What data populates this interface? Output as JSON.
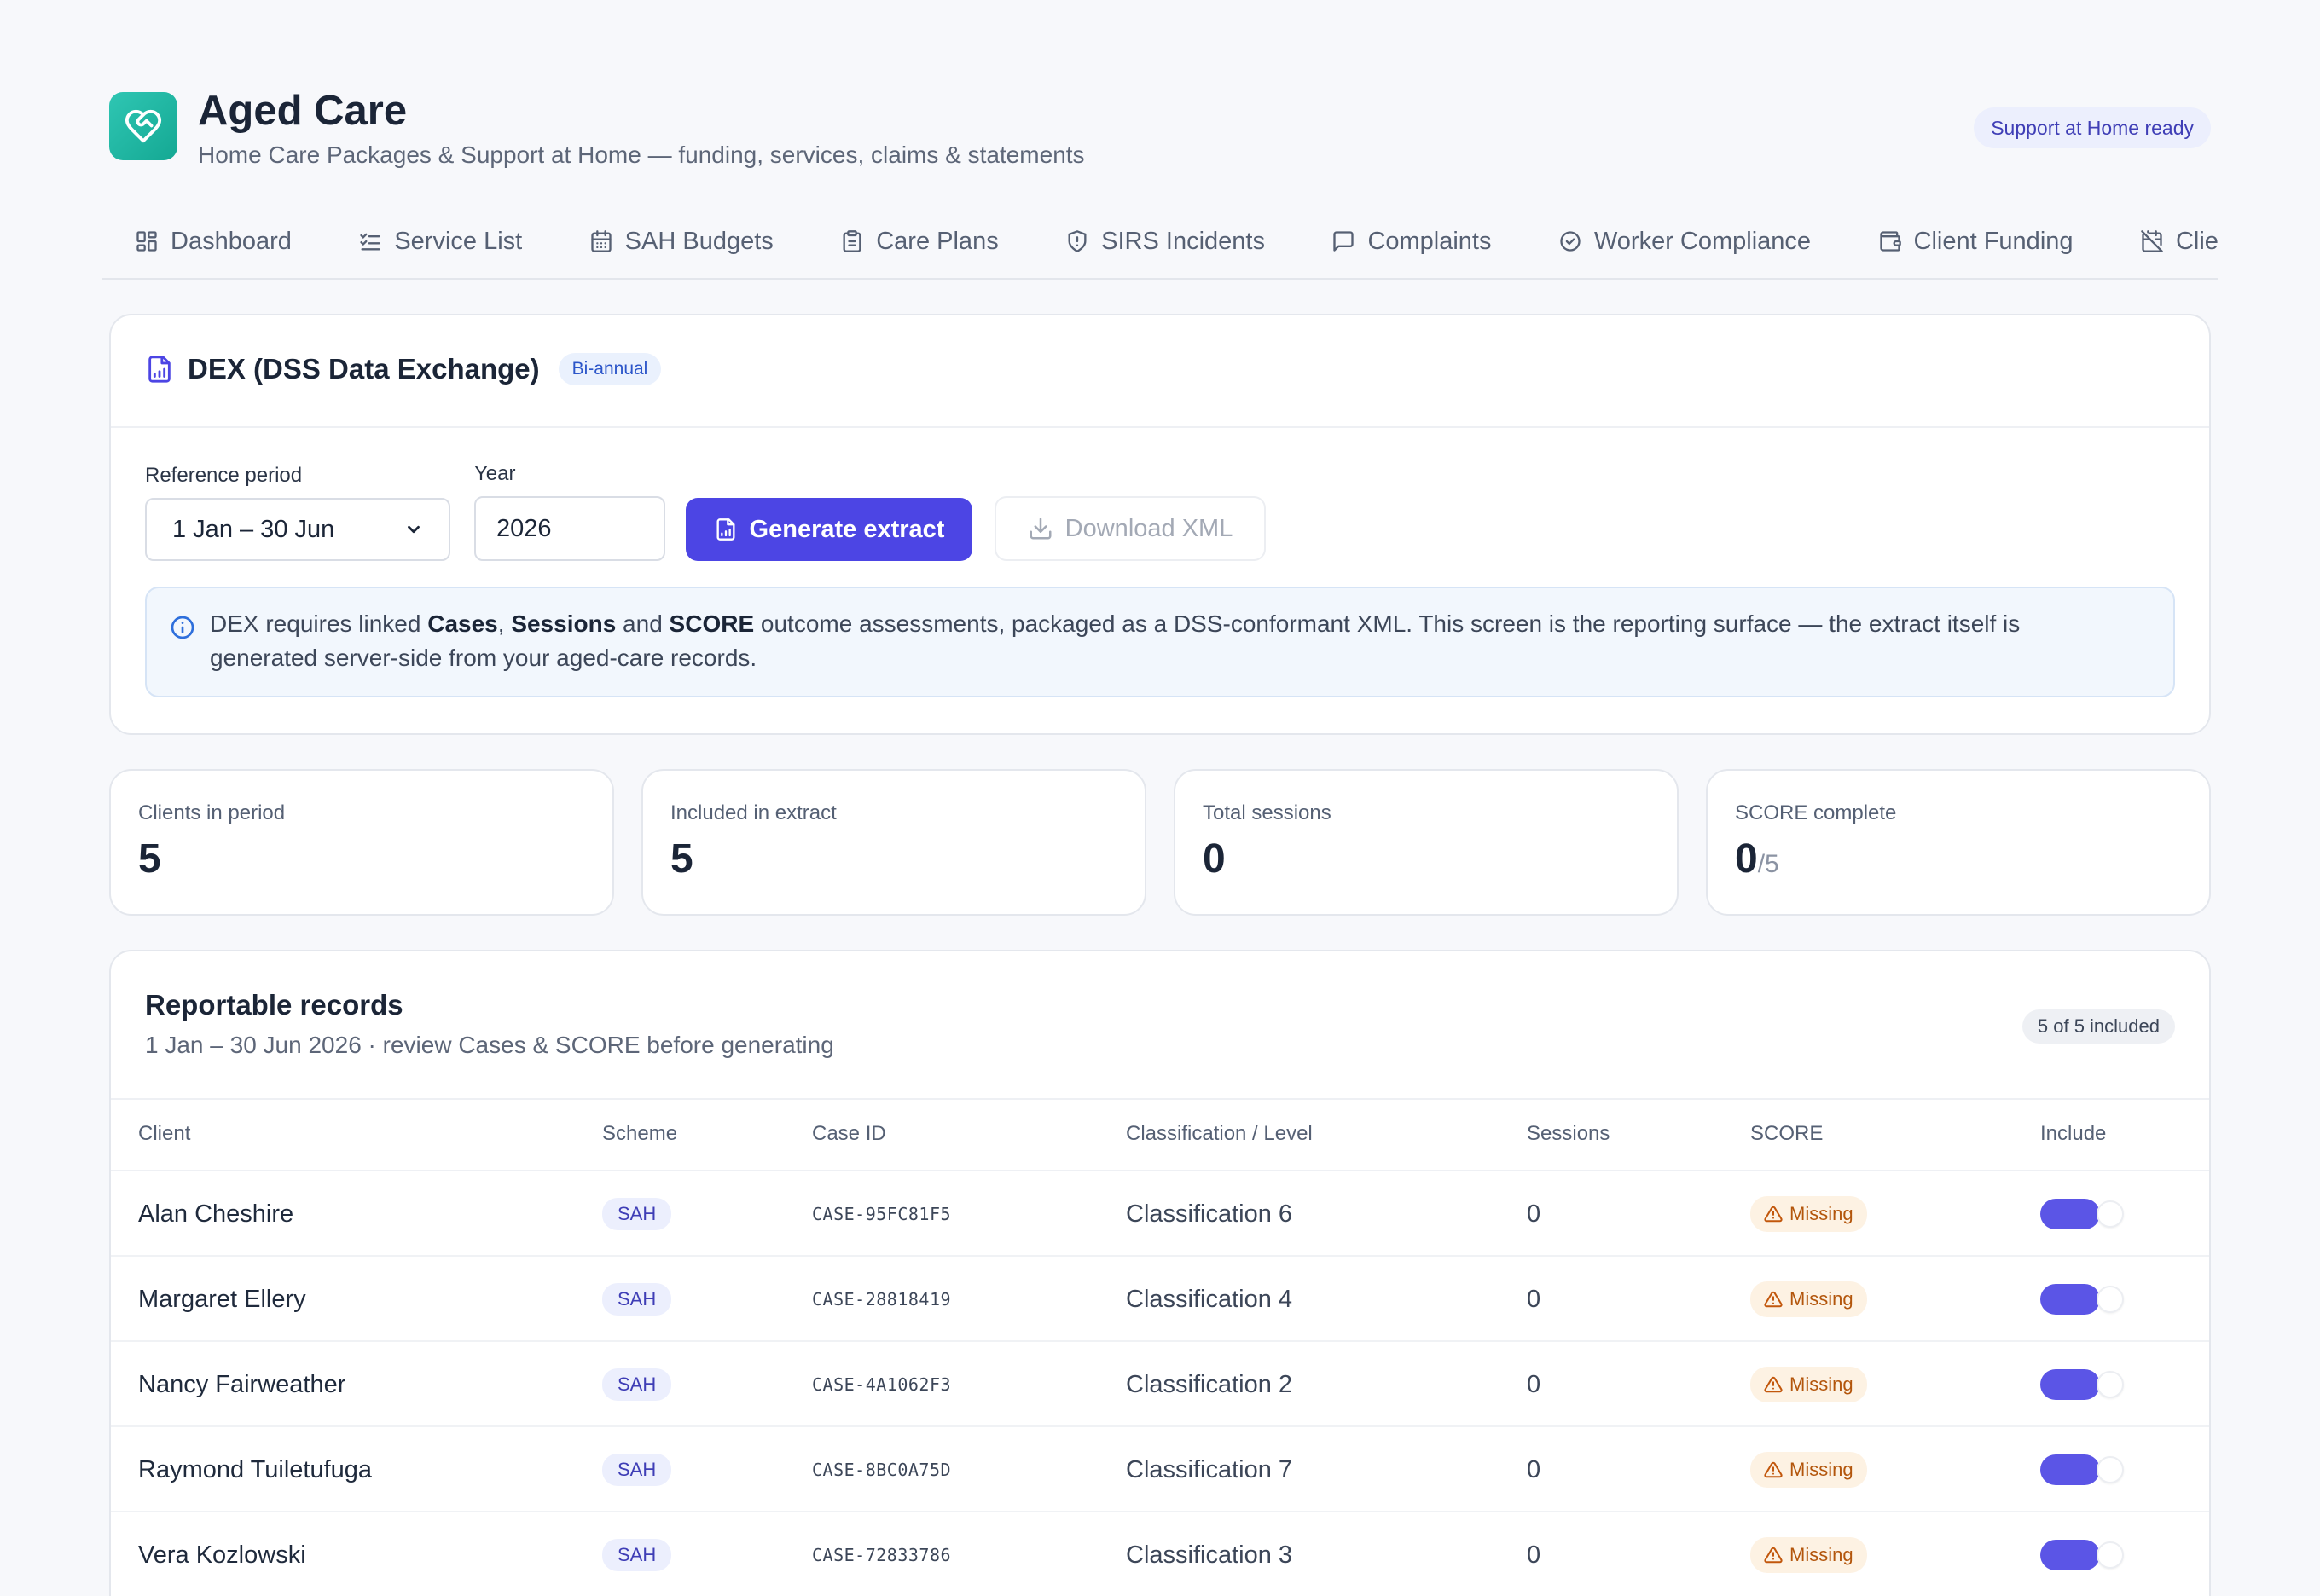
{
  "app": {
    "title": "Aged Care",
    "subtitle": "Home Care Packages & Support at Home — funding, services, claims & statements",
    "ready_badge": "Support at Home ready"
  },
  "tabs": [
    {
      "label": "Dashboard",
      "icon": "dashboard-icon"
    },
    {
      "label": "Service List",
      "icon": "list-checks-icon"
    },
    {
      "label": "SAH Budgets",
      "icon": "calendar-icon"
    },
    {
      "label": "Care Plans",
      "icon": "clipboard-icon"
    },
    {
      "label": "SIRS Incidents",
      "icon": "shield-alert-icon"
    },
    {
      "label": "Complaints",
      "icon": "message-square-icon"
    },
    {
      "label": "Worker Compliance",
      "icon": "check-circle-icon"
    },
    {
      "label": "Client Funding",
      "icon": "wallet-icon"
    },
    {
      "label": "Client L",
      "icon": "calendar-off-icon"
    }
  ],
  "dex": {
    "title": "DEX (DSS Data Exchange)",
    "badge": "Bi-annual",
    "reference_period_label": "Reference period",
    "reference_period_value": "1 Jan – 30 Jun",
    "year_label": "Year",
    "year_value": "2026",
    "generate_label": "Generate extract",
    "download_label": "Download XML",
    "info": {
      "t1": "DEX requires linked ",
      "b1": "Cases",
      "t2": ", ",
      "b2": "Sessions",
      "t3": " and ",
      "b3": "SCORE",
      "t4": " outcome assessments, packaged as a DSS-conformant XML. This screen is the reporting surface — the extract itself is generated server-side from your aged-care records."
    }
  },
  "stats": [
    {
      "label": "Clients in period",
      "value": "5",
      "sub": ""
    },
    {
      "label": "Included in extract",
      "value": "5",
      "sub": ""
    },
    {
      "label": "Total sessions",
      "value": "0",
      "sub": ""
    },
    {
      "label": "SCORE complete",
      "value": "0",
      "sub": "/5"
    }
  ],
  "records": {
    "title": "Reportable records",
    "subtitle": "1 Jan – 30 Jun 2026 · review Cases & SCORE before generating",
    "count_badge": "5 of 5 included",
    "columns": [
      "Client",
      "Scheme",
      "Case ID",
      "Classification / Level",
      "Sessions",
      "SCORE",
      "Include"
    ],
    "rows": [
      {
        "client": "Alan Cheshire",
        "scheme": "SAH",
        "case_id": "CASE-95FC81F5",
        "classification": "Classification 6",
        "sessions": "0",
        "score": "Missing",
        "include": true
      },
      {
        "client": "Margaret Ellery",
        "scheme": "SAH",
        "case_id": "CASE-28818419",
        "classification": "Classification 4",
        "sessions": "0",
        "score": "Missing",
        "include": true
      },
      {
        "client": "Nancy Fairweather",
        "scheme": "SAH",
        "case_id": "CASE-4A1062F3",
        "classification": "Classification 2",
        "sessions": "0",
        "score": "Missing",
        "include": true
      },
      {
        "client": "Raymond Tuiletufuga",
        "scheme": "SAH",
        "case_id": "CASE-8BC0A75D",
        "classification": "Classification 7",
        "sessions": "0",
        "score": "Missing",
        "include": true
      },
      {
        "client": "Vera Kozlowski",
        "scheme": "SAH",
        "case_id": "CASE-72833786",
        "classification": "Classification 3",
        "sessions": "0",
        "score": "Missing",
        "include": true
      }
    ]
  },
  "colors": {
    "accent": "#4c45e4",
    "brand": "#1fb8a4",
    "warning": "#b3560c"
  }
}
